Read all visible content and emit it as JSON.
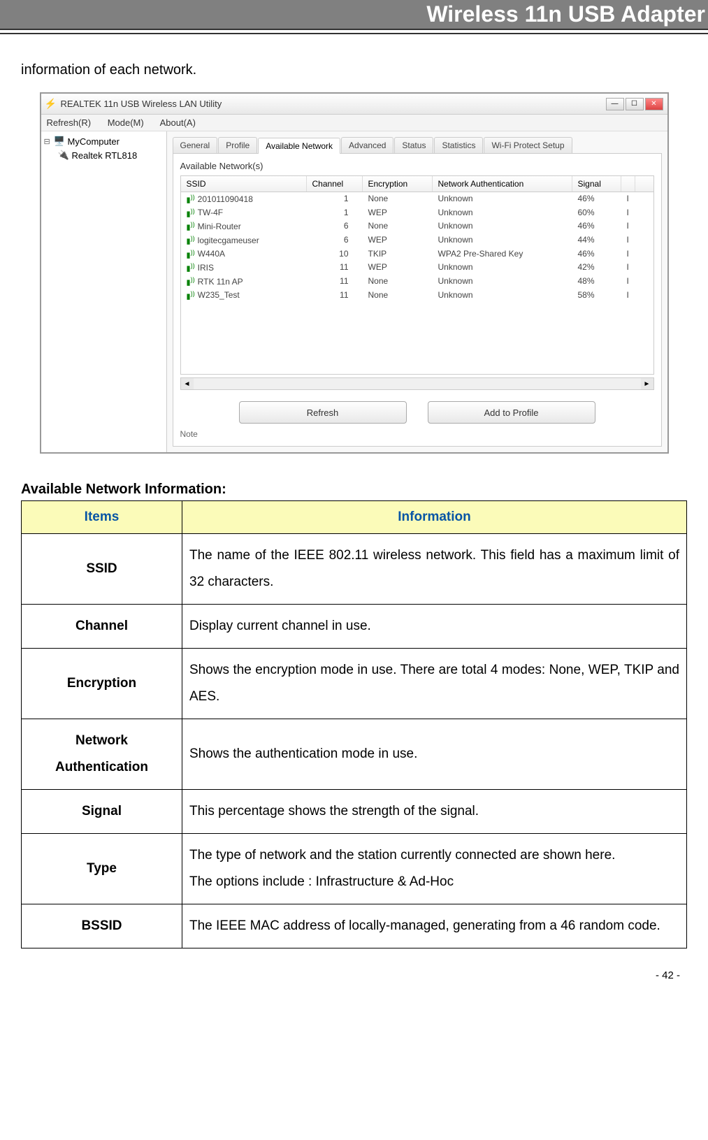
{
  "header": {
    "title": "Wireless 11n USB Adapter"
  },
  "intro": "information of each network.",
  "app": {
    "title": "REALTEK 11n USB Wireless LAN Utility",
    "menu": {
      "refresh": "Refresh(R)",
      "mode": "Mode(M)",
      "about": "About(A)"
    },
    "tree": {
      "root": "MyComputer",
      "child": "Realtek RTL818"
    },
    "tabs": {
      "general": "General",
      "profile": "Profile",
      "available": "Available Network",
      "advanced": "Advanced",
      "status": "Status",
      "statistics": "Statistics",
      "wps": "Wi-Fi Protect Setup"
    },
    "section_label": "Available Network(s)",
    "columns": {
      "ssid": "SSID",
      "channel": "Channel",
      "encryption": "Encryption",
      "auth": "Network Authentication",
      "signal": "Signal"
    },
    "networks": [
      {
        "ssid": "201011090418",
        "channel": "1",
        "encryption": "None",
        "auth": "Unknown",
        "signal": "46%",
        "type": "I"
      },
      {
        "ssid": "TW-4F",
        "channel": "1",
        "encryption": "WEP",
        "auth": "Unknown",
        "signal": "60%",
        "type": "I"
      },
      {
        "ssid": "Mini-Router",
        "channel": "6",
        "encryption": "None",
        "auth": "Unknown",
        "signal": "46%",
        "type": "I"
      },
      {
        "ssid": "logitecgameuser",
        "channel": "6",
        "encryption": "WEP",
        "auth": "Unknown",
        "signal": "44%",
        "type": "I"
      },
      {
        "ssid": "W440A",
        "channel": "10",
        "encryption": "TKIP",
        "auth": "WPA2 Pre-Shared Key",
        "signal": "46%",
        "type": "I"
      },
      {
        "ssid": "IRIS",
        "channel": "11",
        "encryption": "WEP",
        "auth": "Unknown",
        "signal": "42%",
        "type": "I"
      },
      {
        "ssid": "RTK 11n AP",
        "channel": "11",
        "encryption": "None",
        "auth": "Unknown",
        "signal": "48%",
        "type": "I"
      },
      {
        "ssid": "W235_Test",
        "channel": "11",
        "encryption": "None",
        "auth": "Unknown",
        "signal": "58%",
        "type": "I"
      }
    ],
    "buttons": {
      "refresh": "Refresh",
      "add_profile": "Add to Profile"
    },
    "note": "Note"
  },
  "info_section": {
    "heading": "Available Network Information:",
    "header_items": "Items",
    "header_info": "Information",
    "rows": [
      {
        "item": "SSID",
        "info": "The name of the IEEE 802.11 wireless network. This field has a maximum limit of 32 characters."
      },
      {
        "item": "Channel",
        "info": "Display current channel in use."
      },
      {
        "item": "Encryption",
        "info": "Shows the encryption mode in use. There are total 4 modes: None, WEP, TKIP and AES."
      },
      {
        "item": "Network Authentication",
        "info": "Shows the authentication mode in use."
      },
      {
        "item": "Signal",
        "info": "This percentage shows the strength of the signal."
      },
      {
        "item": "Type",
        "info": "The type of network and the station currently connected are shown here.\nThe options include : Infrastructure & Ad-Hoc"
      },
      {
        "item": "BSSID",
        "info": "The IEEE MAC address of locally-managed, generating from a 46 random code."
      }
    ]
  },
  "page_number": "- 42 -"
}
